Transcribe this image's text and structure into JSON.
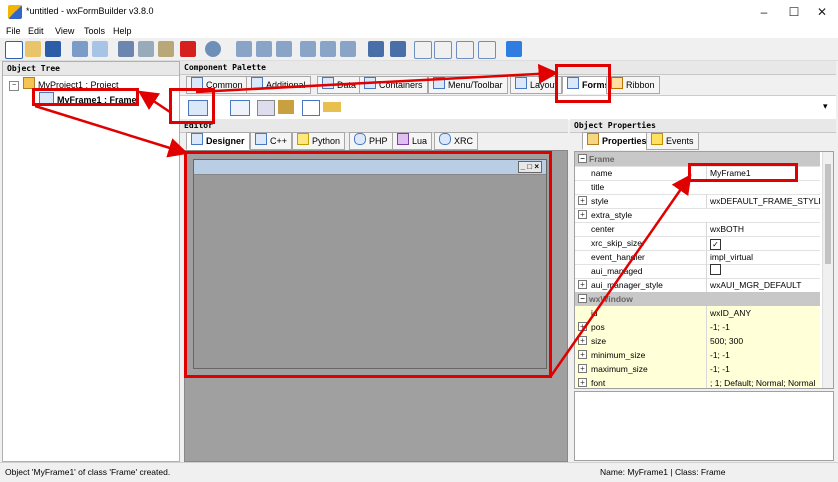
{
  "window": {
    "title": "*untitled - wxFormBuilder v3.8.0",
    "minimize": "–",
    "maximize": "☐",
    "close": "✕"
  },
  "menu": [
    "File",
    "Edit",
    "View",
    "Tools",
    "Help"
  ],
  "object_tree": {
    "header": "Object Tree",
    "project": "MyProject1 : Project",
    "frame": "MyFrame1 : Frame"
  },
  "component_palette": {
    "header": "Component Palette",
    "tabs": [
      "Common",
      "Additional",
      "Data",
      "Containers",
      "Menu/Toolbar",
      "Layout",
      "Forms",
      "Ribbon"
    ],
    "active_tab": "Forms"
  },
  "editor": {
    "header": "Editor",
    "tabs": [
      "Designer",
      "C++",
      "Python",
      "PHP",
      "Lua",
      "XRC"
    ],
    "frame_buttons": "_ □ ×"
  },
  "object_properties": {
    "header": "Object Properties",
    "tabs": [
      "Properties",
      "Events"
    ],
    "rows": [
      {
        "kind": "cat",
        "name": "Frame",
        "value": ""
      },
      {
        "kind": "prop",
        "name": "name",
        "value": "MyFrame1"
      },
      {
        "kind": "prop",
        "name": "title",
        "value": ""
      },
      {
        "kind": "expand",
        "name": "style",
        "value": "wxDEFAULT_FRAME_STYLE"
      },
      {
        "kind": "expand",
        "name": "extra_style",
        "value": ""
      },
      {
        "kind": "prop",
        "name": "center",
        "value": "wxBOTH"
      },
      {
        "kind": "check",
        "name": "xrc_skip_sizer",
        "value": "✓"
      },
      {
        "kind": "prop",
        "name": "event_handler",
        "value": "impl_virtual"
      },
      {
        "kind": "check",
        "name": "aui_managed",
        "value": ""
      },
      {
        "kind": "expand",
        "name": "aui_manager_style",
        "value": "wxAUI_MGR_DEFAULT"
      },
      {
        "kind": "cat",
        "name": "wxWindow",
        "value": ""
      },
      {
        "kind": "yellow",
        "name": "id",
        "value": "wxID_ANY"
      },
      {
        "kind": "yellow-expand",
        "name": "pos",
        "value": "-1; -1"
      },
      {
        "kind": "yellow-expand",
        "name": "size",
        "value": "500; 300"
      },
      {
        "kind": "yellow-expand",
        "name": "minimum_size",
        "value": "-1; -1"
      },
      {
        "kind": "yellow-expand",
        "name": "maximum_size",
        "value": "-1; -1"
      },
      {
        "kind": "yellow-expand",
        "name": "font",
        "value": "; 1; Default; Normal; Normal"
      }
    ]
  },
  "status": {
    "left": "Object 'MyFrame1' of class 'Frame' created.",
    "right": "Name: MyFrame1 | Class: Frame"
  },
  "colors": {
    "highlight": "#e00000",
    "designer_bg": "#a0a0a0",
    "frame_title": "#b9cde5"
  }
}
